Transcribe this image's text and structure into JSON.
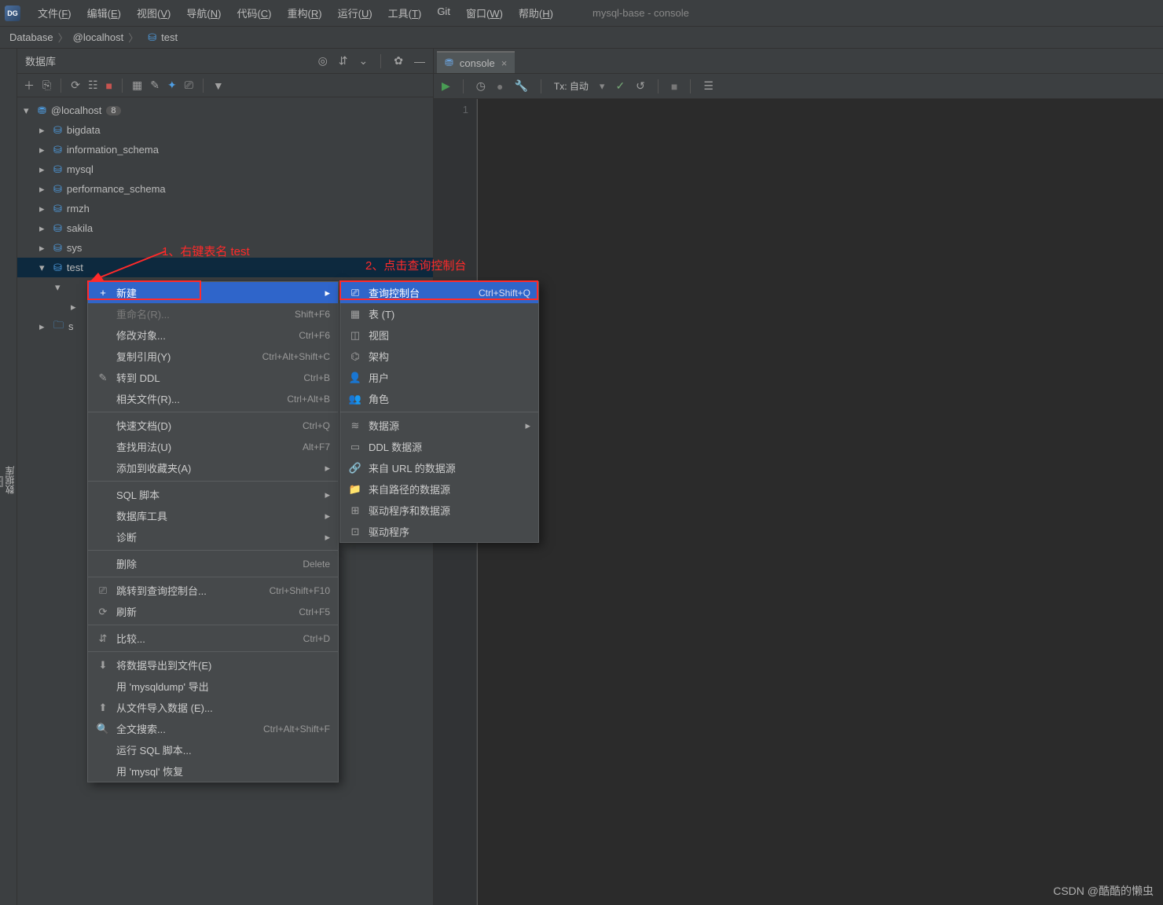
{
  "app": {
    "title": "mysql-base - console"
  },
  "menubar": [
    {
      "label": "文件",
      "mn": "F"
    },
    {
      "label": "编辑",
      "mn": "E"
    },
    {
      "label": "视图",
      "mn": "V"
    },
    {
      "label": "导航",
      "mn": "N"
    },
    {
      "label": "代码",
      "mn": "C"
    },
    {
      "label": "重构",
      "mn": "R"
    },
    {
      "label": "运行",
      "mn": "U"
    },
    {
      "label": "工具",
      "mn": "T"
    },
    {
      "label": "Git",
      "mn": ""
    },
    {
      "label": "窗口",
      "mn": "W"
    },
    {
      "label": "帮助",
      "mn": "H"
    }
  ],
  "breadcrumbs": {
    "a": "Database",
    "b": "@localhost",
    "c": "test"
  },
  "sidebar": {
    "title": "数据库",
    "host": "@localhost",
    "host_badge": "8",
    "items": [
      "bigdata",
      "information_schema",
      "mysql",
      "performance_schema",
      "rmzh",
      "sakila",
      "sys",
      "test"
    ]
  },
  "rail": {
    "label": "数据库"
  },
  "editor": {
    "tab_label": "console",
    "tx_label": "Tx: 自动",
    "line": "1"
  },
  "annotations": {
    "a1": "1、右键表名 test",
    "a2": "2、点击查询控制台"
  },
  "context_menu": [
    {
      "icon": "+",
      "label": "新建",
      "arrow": true,
      "highlight": true
    },
    {
      "label": "重命名(R)...",
      "shortcut": "Shift+F6",
      "disabled": true
    },
    {
      "label": "修改对象...",
      "shortcut": "Ctrl+F6"
    },
    {
      "label": "复制引用(Y)",
      "shortcut": "Ctrl+Alt+Shift+C"
    },
    {
      "icon": "✎",
      "label": "转到 DDL",
      "shortcut": "Ctrl+B"
    },
    {
      "label": "相关文件(R)...",
      "shortcut": "Ctrl+Alt+B"
    },
    {
      "sep": true
    },
    {
      "label": "快速文档(D)",
      "shortcut": "Ctrl+Q"
    },
    {
      "label": "查找用法(U)",
      "shortcut": "Alt+F7"
    },
    {
      "label": "添加到收藏夹(A)",
      "arrow": true
    },
    {
      "sep": true
    },
    {
      "label": "SQL 脚本",
      "arrow": true
    },
    {
      "label": "数据库工具",
      "arrow": true
    },
    {
      "label": "诊断",
      "arrow": true
    },
    {
      "sep": true
    },
    {
      "label": "删除",
      "shortcut": "Delete"
    },
    {
      "sep": true
    },
    {
      "icon": "⎚",
      "label": "跳转到查询控制台...",
      "shortcut": "Ctrl+Shift+F10"
    },
    {
      "icon": "⟳",
      "label": "刷新",
      "shortcut": "Ctrl+F5"
    },
    {
      "sep": true
    },
    {
      "icon": "⇵",
      "label": "比较...",
      "shortcut": "Ctrl+D"
    },
    {
      "sep": true
    },
    {
      "icon": "⬇",
      "label": "将数据导出到文件(E)"
    },
    {
      "label": "用 'mysqldump' 导出"
    },
    {
      "icon": "⬆",
      "label": "从文件导入数据 (E)..."
    },
    {
      "icon": "🔍",
      "label": "全文搜索...",
      "shortcut": "Ctrl+Alt+Shift+F"
    },
    {
      "label": "运行 SQL 脚本..."
    },
    {
      "label": "用 'mysql' 恢复"
    }
  ],
  "submenu": [
    {
      "icon": "⎚",
      "label": "查询控制台",
      "shortcut": "Ctrl+Shift+Q",
      "highlight": true
    },
    {
      "icon": "▦",
      "label": "表 (T)"
    },
    {
      "icon": "◫",
      "label": "视图"
    },
    {
      "icon": "⌬",
      "label": "架构"
    },
    {
      "icon": "👤",
      "label": "用户"
    },
    {
      "icon": "👥",
      "label": "角色"
    },
    {
      "sep": true
    },
    {
      "icon": "≋",
      "label": "数据源",
      "arrow": true
    },
    {
      "icon": "▭",
      "label": "DDL 数据源"
    },
    {
      "icon": "🔗",
      "label": "来自 URL 的数据源"
    },
    {
      "icon": "📁",
      "label": "来自路径的数据源"
    },
    {
      "icon": "⊞",
      "label": "驱动程序和数据源"
    },
    {
      "icon": "⊡",
      "label": "驱动程序"
    }
  ],
  "watermark": "CSDN @酷酷的懒虫"
}
